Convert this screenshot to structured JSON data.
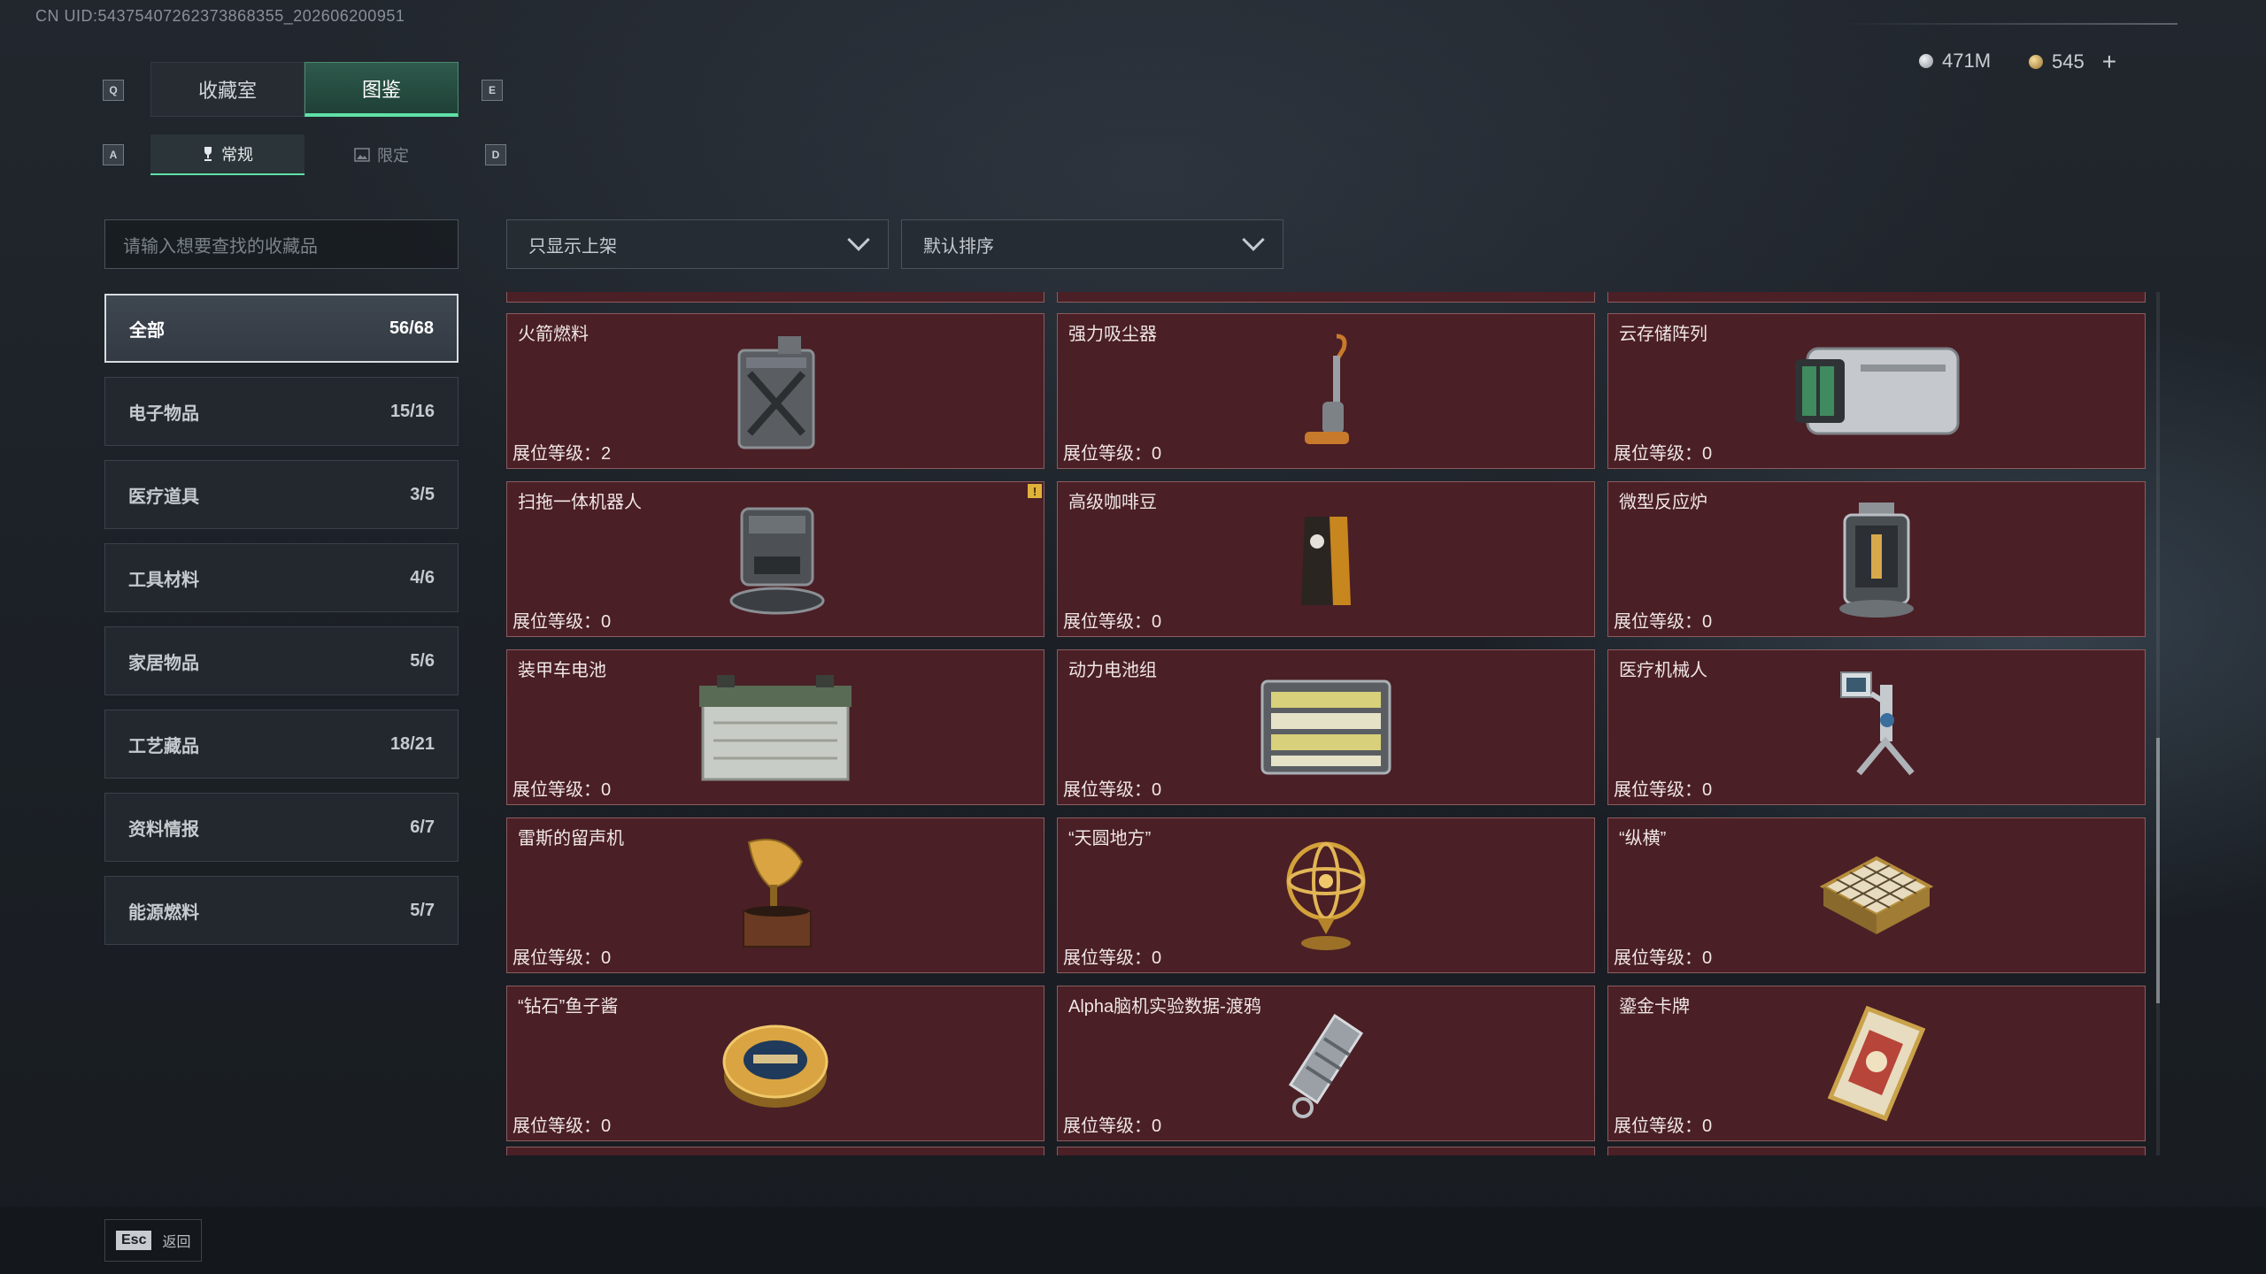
{
  "uid": "CN UID:54375407262373868355_202606200951",
  "currency": {
    "silver_amount": "471M",
    "gold_amount": "545",
    "add_symbol": "+"
  },
  "keys": {
    "prev_tab": "Q",
    "next_tab": "E",
    "prev_sub": "A",
    "next_sub": "D"
  },
  "tabs": [
    {
      "label": "收藏室",
      "active": false
    },
    {
      "label": "图鉴",
      "active": true
    }
  ],
  "subtabs": [
    {
      "label": "常规",
      "icon": "trophy-icon",
      "active": true
    },
    {
      "label": "限定",
      "icon": "image-icon",
      "active": false
    }
  ],
  "search": {
    "placeholder": "请输入想要查找的收藏品"
  },
  "filters": {
    "shelf_filter": "只显示上架",
    "sort": "默认排序"
  },
  "categories": [
    {
      "label": "全部",
      "count": "56/68",
      "active": true
    },
    {
      "label": "电子物品",
      "count": "15/16",
      "active": false
    },
    {
      "label": "医疗道具",
      "count": "3/5",
      "active": false
    },
    {
      "label": "工具材料",
      "count": "4/6",
      "active": false
    },
    {
      "label": "家居物品",
      "count": "5/6",
      "active": false
    },
    {
      "label": "工艺藏品",
      "count": "18/21",
      "active": false
    },
    {
      "label": "资料情报",
      "count": "6/7",
      "active": false
    },
    {
      "label": "能源燃料",
      "count": "5/7",
      "active": false
    }
  ],
  "items": [
    {
      "name": "火箭燃料",
      "level": "展位等级：2",
      "icon": "fuel-canister-icon",
      "warn": false
    },
    {
      "name": "强力吸尘器",
      "level": "展位等级：0",
      "icon": "vacuum-cleaner-icon",
      "warn": false
    },
    {
      "name": "云存储阵列",
      "level": "展位等级：0",
      "icon": "storage-array-icon",
      "warn": false
    },
    {
      "name": "扫拖一体机器人",
      "level": "展位等级：0",
      "icon": "mop-robot-icon",
      "warn": true
    },
    {
      "name": "高级咖啡豆",
      "level": "展位等级：0",
      "icon": "coffee-bag-icon",
      "warn": false
    },
    {
      "name": "微型反应炉",
      "level": "展位等级：0",
      "icon": "reactor-icon",
      "warn": false
    },
    {
      "name": "装甲车电池",
      "level": "展位等级：0",
      "icon": "vehicle-battery-icon",
      "warn": false
    },
    {
      "name": "动力电池组",
      "level": "展位等级：0",
      "icon": "battery-pack-icon",
      "warn": false
    },
    {
      "name": "医疗机械人",
      "level": "展位等级：0",
      "icon": "medical-robot-icon",
      "warn": false
    },
    {
      "name": "雷斯的留声机",
      "level": "展位等级：0",
      "icon": "gramophone-icon",
      "warn": false
    },
    {
      "name": "“天圆地方”",
      "level": "展位等级：0",
      "icon": "armillary-sphere-icon",
      "warn": false
    },
    {
      "name": "“纵横”",
      "level": "展位等级：0",
      "icon": "chessboard-icon",
      "warn": false
    },
    {
      "name": "“钻石”鱼子酱",
      "level": "展位等级：0",
      "icon": "caviar-tin-icon",
      "warn": false
    },
    {
      "name": "Alpha脑机实验数据-渡鸦",
      "level": "展位等级：0",
      "icon": "data-drive-icon",
      "warn": false
    },
    {
      "name": "鎏金卡牌",
      "level": "展位等级：0",
      "icon": "gold-card-icon",
      "warn": false
    }
  ],
  "footer": {
    "esc_key": "Esc",
    "esc_label": "返回"
  }
}
